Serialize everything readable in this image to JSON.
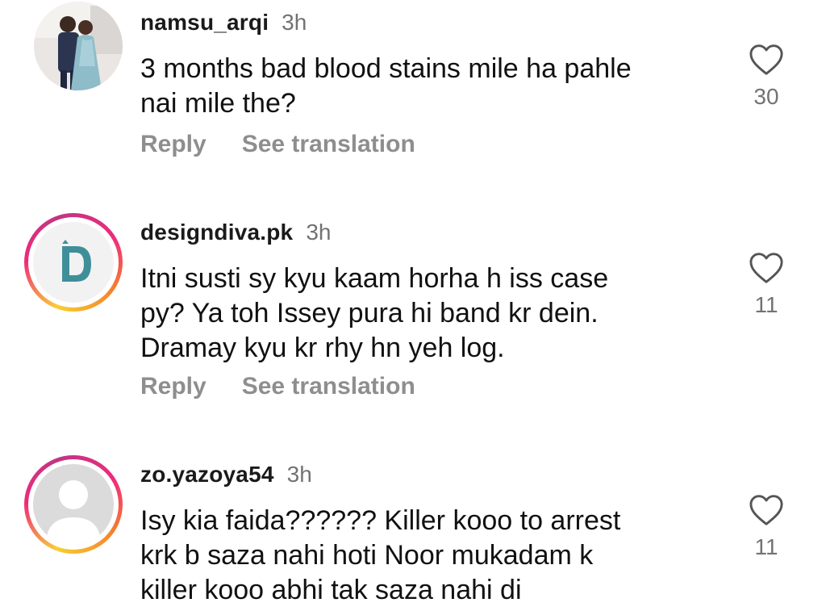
{
  "comments": [
    {
      "username": "namsu_arqi",
      "time": "3h",
      "text_lines": [
        "3 months bad blood stains mile ha pahle",
        "nai mile the?"
      ],
      "reply_label": "Reply",
      "translate_label": "See translation",
      "likes": "30",
      "avatar": "photo-avatar"
    },
    {
      "username": "designdiva.pk",
      "time": "3h",
      "text_lines": [
        "Itni susti sy kyu kaam horha h iss case",
        "py? Ya toh Issey pura hi band kr dein.",
        "Dramay kyu kr rhy hn yeh log."
      ],
      "reply_label": "Reply",
      "translate_label": "See translation",
      "likes": "11",
      "avatar": "logo-d-avatar"
    },
    {
      "username": "zo.yazoya54",
      "time": "3h",
      "text_lines": [
        "Isy kia faida?????? Killer kooo to arrest",
        "krk b saza nahi hoti Noor mukadam k",
        "killer kooo abhi tak saza nahi di"
      ],
      "likes": "11",
      "avatar": "default-person-avatar"
    }
  ],
  "colors": {
    "muted": "#8e8e8e",
    "time": "#737373",
    "story_ring_start": "#f9ce34",
    "story_ring_mid": "#ee2a7b",
    "story_ring_end": "#c13584"
  }
}
